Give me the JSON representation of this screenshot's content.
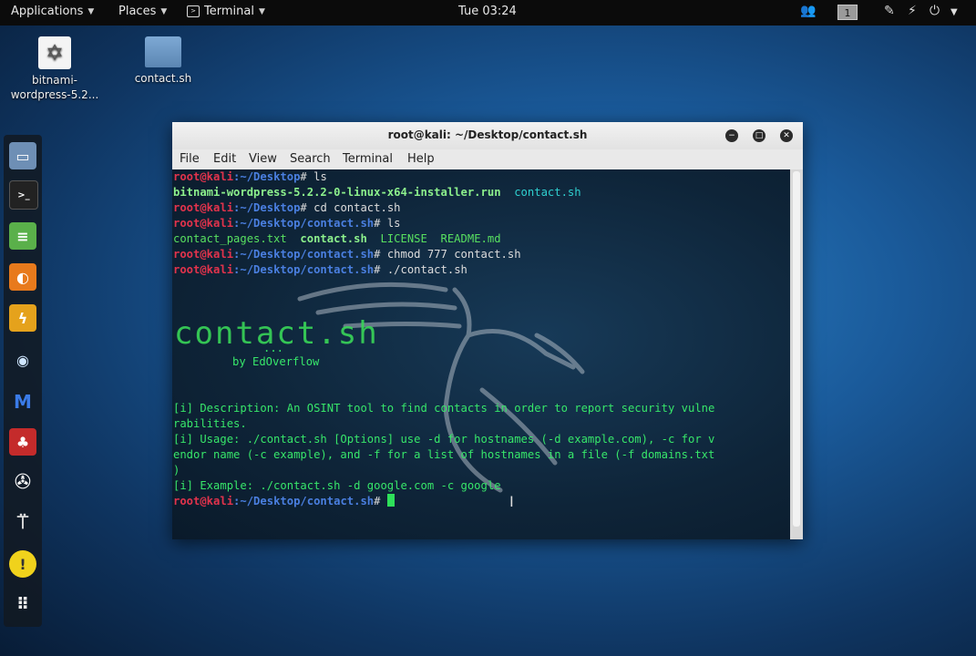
{
  "topbar": {
    "applications": "Applications",
    "places": "Places",
    "terminal_app": "Terminal",
    "clock": "Tue 03:24",
    "workspace": "1"
  },
  "desktop": {
    "icons": [
      {
        "label": "bitnami-\nwordpress-5.2...",
        "icon": "installer-icon"
      },
      {
        "label": "contact.sh",
        "icon": "folder-icon"
      }
    ]
  },
  "window": {
    "title": "root@kali: ~/Desktop/contact.sh",
    "menu": [
      "File",
      "Edit",
      "View",
      "Search",
      "Terminal",
      "Help"
    ]
  },
  "terminal": {
    "prompt_user": "root@kali",
    "path_desktop": ":~/Desktop",
    "path_contact": ":~/Desktop/contact.sh",
    "hash": "#",
    "cmd1": " ls",
    "ls1_a": "bitnami-wordpress-5.2.2-0-linux-x64-installer.run",
    "ls1_b": "  contact.sh",
    "cmd2": " cd contact.sh",
    "cmd3": " ls",
    "ls2_a": "contact_pages.txt  ",
    "ls2_b": "contact.sh",
    "ls2_c": "  LICENSE  README.md",
    "cmd4": " chmod 777 contact.sh",
    "cmd5": " ./contact.sh",
    "banner": "contact.sh",
    "banner_dots": "...",
    "byline": "by EdOverflow",
    "desc1": "[i] Description: An OSINT tool to find contacts in order to report security vulne",
    "desc2": "rabilities.",
    "usage1": "[i] Usage: ./contact.sh [Options] use -d for hostnames (-d example.com), -c for v",
    "usage2": "endor name (-c example), and -f for a list of hostnames in a file (-f domains.txt",
    "usage3": ")",
    "example": "[i] Example: ./contact.sh -d google.com -c google"
  }
}
